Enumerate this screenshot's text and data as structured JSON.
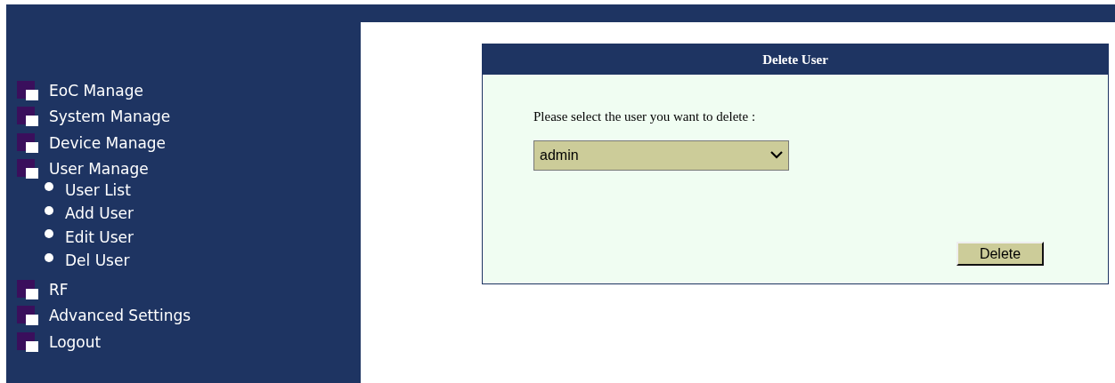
{
  "menu": [
    {
      "label": "EoC Manage"
    },
    {
      "label": "System Manage"
    },
    {
      "label": "Device Manage"
    },
    {
      "label": "User Manage",
      "children": [
        {
          "label": "User List"
        },
        {
          "label": "Add User"
        },
        {
          "label": "Edit User"
        },
        {
          "label": "Del User"
        }
      ]
    },
    {
      "label": "RF"
    },
    {
      "label": "Advanced Settings"
    },
    {
      "label": "Logout"
    }
  ],
  "panel": {
    "title": "Delete User",
    "prompt": "Please select the user you want to delete :",
    "select_value": "admin",
    "button": "Delete"
  }
}
